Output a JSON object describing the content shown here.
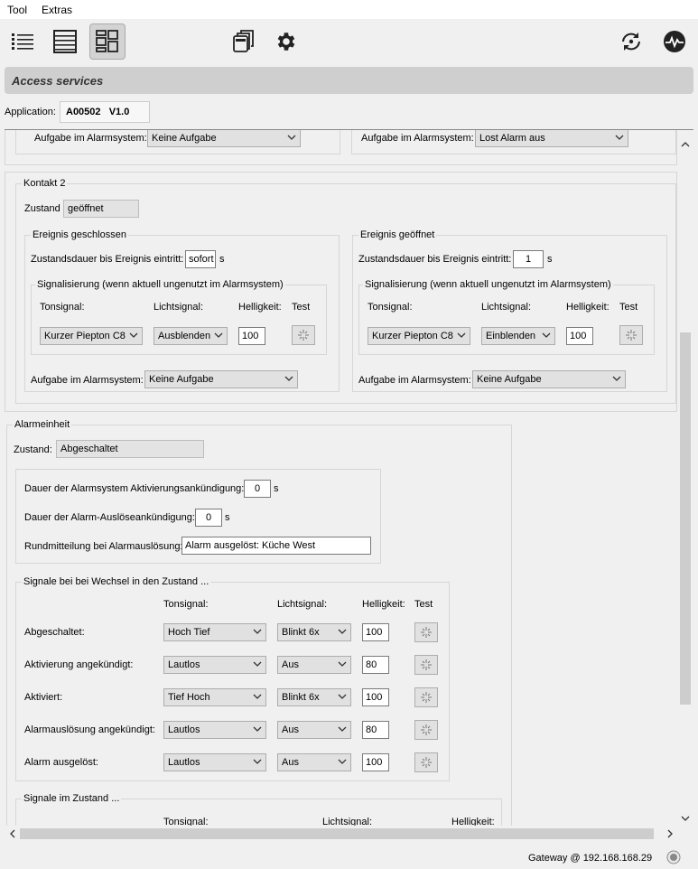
{
  "menu": {
    "tool": "Tool",
    "extras": "Extras"
  },
  "toolbar": {
    "icons": [
      "list-icon",
      "table-icon",
      "dashboard-icon",
      "copy-icon",
      "gear-icon",
      "sync-icon",
      "heartbeat-icon"
    ]
  },
  "title": "Access services",
  "application": {
    "label": "Application:",
    "value": "A00502   V1.0"
  },
  "top_partial": {
    "left_task_label": "Aufgabe im Alarmsystem:",
    "left_task_value": "Keine Aufgabe",
    "right_task_label": "Aufgabe im Alarmsystem:",
    "right_task_value": "Lost Alarm aus"
  },
  "kontakt2": {
    "title": "Kontakt 2",
    "state_label": "Zustand",
    "state_value": "geöffnet",
    "closed": {
      "title": "Ereignis geschlossen",
      "duration_label": "Zustandsdauer bis Ereignis eintritt:",
      "duration_value": "sofort",
      "duration_unit": "s",
      "signal_title": "Signalisierung (wenn aktuell ungenutzt im Alarmsystem)",
      "col_tone": "Tonsignal:",
      "col_light": "Lichtsignal:",
      "col_bright": "Helligkeit:",
      "col_test": "Test",
      "tone": "Kurzer Piepton C8",
      "light": "Ausblenden",
      "bright": "100",
      "task_label": "Aufgabe im Alarmsystem:",
      "task_value": "Keine Aufgabe"
    },
    "opened": {
      "title": "Ereignis geöffnet",
      "duration_label": "Zustandsdauer bis Ereignis eintritt:",
      "duration_value": "1",
      "duration_unit": "s",
      "signal_title": "Signalisierung (wenn aktuell ungenutzt im Alarmsystem)",
      "col_tone": "Tonsignal:",
      "col_light": "Lichtsignal:",
      "col_bright": "Helligkeit:",
      "col_test": "Test",
      "tone": "Kurzer Piepton C8",
      "light": "Einblenden",
      "bright": "100",
      "task_label": "Aufgabe im Alarmsystem:",
      "task_value": "Keine Aufgabe"
    }
  },
  "alarm": {
    "title": "Alarmeinheit",
    "state_label": "Zustand:",
    "state_value": "Abgeschaltet",
    "activation_label": "Dauer der Alarmsystem Aktivierungsankündigung:",
    "activation_value": "0",
    "activation_unit": "s",
    "trigger_label": "Dauer der Alarm-Auslöseankündigung:",
    "trigger_value": "0",
    "trigger_unit": "s",
    "broadcast_label": "Rundmitteilung bei Alarmauslösung:",
    "broadcast_value": "Alarm ausgelöst: Küche West",
    "signals": {
      "title": "Signale bei bei Wechsel in den Zustand ...",
      "col_tone": "Tonsignal:",
      "col_light": "Lichtsignal:",
      "col_bright": "Helligkeit:",
      "col_test": "Test",
      "rows": [
        {
          "label": "Abgeschaltet:",
          "tone": "Hoch Tief",
          "light": "Blinkt 6x",
          "bright": "100"
        },
        {
          "label": "Aktivierung angekündigt:",
          "tone": "Lautlos",
          "light": "Aus",
          "bright": "80"
        },
        {
          "label": "Aktiviert:",
          "tone": "Tief Hoch",
          "light": "Blinkt 6x",
          "bright": "100"
        },
        {
          "label": "Alarmauslösung angekündigt:",
          "tone": "Lautlos",
          "light": "Aus",
          "bright": "80"
        },
        {
          "label": "Alarm ausgelöst:",
          "tone": "Lautlos",
          "light": "Aus",
          "bright": "100"
        }
      ]
    },
    "signals_state": {
      "title": "Signale im Zustand ...",
      "col_tone": "Tonsignal:",
      "col_light": "Lichtsignal:",
      "col_bright": "Helligkeit:"
    }
  },
  "status": {
    "gateway": "Gateway @ 192.168.168.29"
  }
}
